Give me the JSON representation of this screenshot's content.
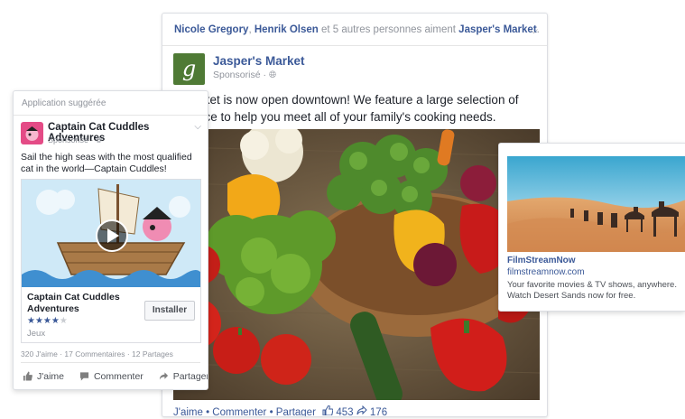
{
  "main_post": {
    "liked_by": {
      "name_1": "Nicole Gregory",
      "comma": ",",
      "name_2": "Henrik Olsen",
      "text": "et 5 autres personnes aiment",
      "page": "Jasper's Market"
    },
    "page_name": "Jasper's Market",
    "logo_letter": "g",
    "sponsored": "Sponsorisé · ",
    "text": "s Market is now open downtown! We feature a large selection of produce to help you meet all of your family's cooking needs.",
    "actions": {
      "like": "J'aime",
      "sep": " • ",
      "comment": "Commenter",
      "share": "Partager",
      "likes_count": "453",
      "shares_count": "176"
    }
  },
  "suggested_app": {
    "header": "Application suggérée",
    "app_name": "Captain Cat Cuddles Adventures",
    "sponsored": "Sponsorisé · ",
    "description": "Sail the high seas with the most qualified cat in the world—Captain Cuddles!",
    "title": "Captain Cat Cuddles Adventures",
    "rating": 4,
    "stars": "★★★★",
    "stars_off": "★",
    "category": "Jeux",
    "install_label": "Installer",
    "stats": "320 J'aime · 17 Commentaires · 12 Partages",
    "actions": {
      "like": "J'aime",
      "comment": "Commenter",
      "share": "Partager"
    }
  },
  "side_ad": {
    "title": "FilmStreamNow",
    "url": "filmstreamnow.com",
    "description": "Your favorite movies & TV shows, anywhere. Watch Desert Sands now for free."
  },
  "colors": {
    "link_blue": "#3b5998",
    "muted_gray": "#90949c",
    "logo_green": "#4f7a35",
    "app_pink": "#e44b86"
  },
  "icons": [
    "globe-icon",
    "chevron-down-icon",
    "thumbs-up-icon",
    "comment-icon",
    "share-icon",
    "play-icon",
    "share-arrow-icon"
  ]
}
